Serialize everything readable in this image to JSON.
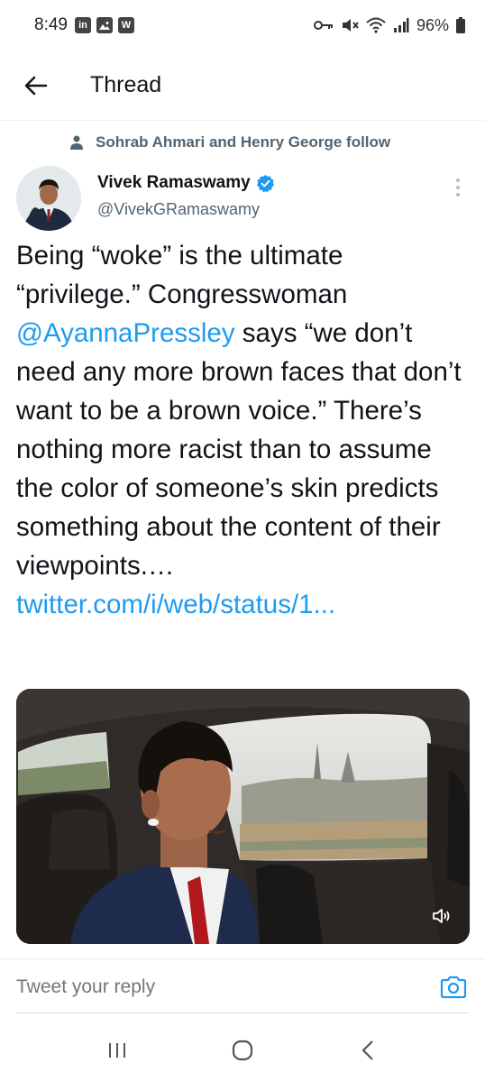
{
  "status_bar": {
    "time": "8:49",
    "left_badges": [
      "in",
      "img",
      "W"
    ],
    "battery": "96%"
  },
  "header": {
    "title": "Thread"
  },
  "tweet": {
    "social_context": "Sohrab Ahmari and Henry George follow",
    "author_name": "Vivek Ramaswamy",
    "author_handle": "@VivekGRamaswamy",
    "verified": true,
    "text_part1": "Being “woke” is the ultimate “privilege.” Congresswoman ",
    "mention": "@AyannaPressley",
    "text_part2": " says “we don’t need any more brown faces that don’t want to be a brown voice.” There’s nothing more racist than to assume the color of someone’s skin predicts something about the content of their viewpoints.… ",
    "link": "twitter.com/i/web/status/1..."
  },
  "reply": {
    "placeholder": "Tweet your reply"
  },
  "colors": {
    "accent": "#1d9bf0",
    "text": "#0f1419",
    "secondary": "#536471"
  },
  "icons": {
    "back": "arrow-left-icon",
    "verified": "verified-badge-icon",
    "more": "more-vertical-icon",
    "volume": "volume-icon",
    "camera": "camera-icon",
    "person": "person-icon"
  }
}
